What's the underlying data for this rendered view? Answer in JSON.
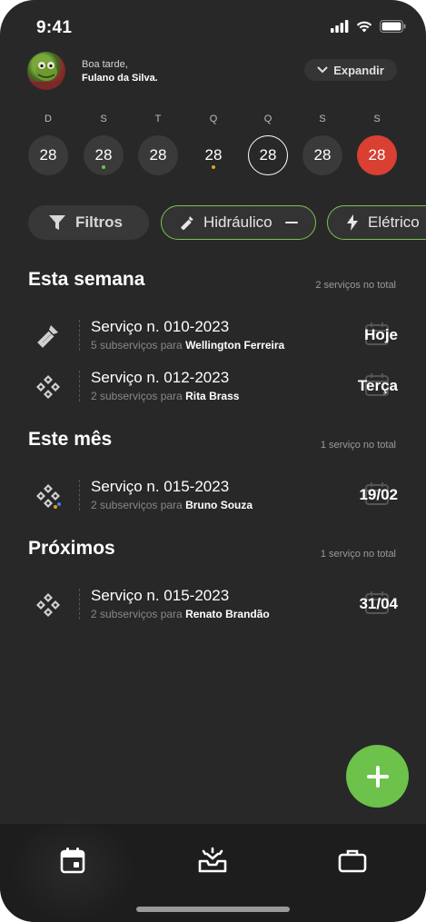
{
  "status": {
    "time": "9:41"
  },
  "header": {
    "greeting": "Boa tarde,",
    "user_name": "Fulano da Silva.",
    "expand_label": "Expandir"
  },
  "week": [
    {
      "letter": "D",
      "day": "28",
      "state": "normal",
      "dot": null
    },
    {
      "letter": "S",
      "day": "28",
      "state": "normal",
      "dot": "#6cc24a"
    },
    {
      "letter": "T",
      "day": "28",
      "state": "normal",
      "dot": null
    },
    {
      "letter": "Q",
      "day": "28",
      "state": "normal",
      "dot": "#e0a020"
    },
    {
      "letter": "Q",
      "day": "28",
      "state": "today",
      "dot": null
    },
    {
      "letter": "S",
      "day": "28",
      "state": "normal",
      "dot": null
    },
    {
      "letter": "S",
      "day": "28",
      "state": "selected",
      "dot": null
    }
  ],
  "filters": {
    "filter_label": "Filtros",
    "chip1_label": "Hidráulico",
    "chip2_label": "Elétrico"
  },
  "sections": [
    {
      "title": "Esta semana",
      "count": "2 serviços no total",
      "items": [
        {
          "icon": "wrench-icon",
          "title": "Serviço n. 010-2023",
          "sub_prefix": "5 subserviços para",
          "person": "Wellington Ferreira",
          "date": "Hoje"
        },
        {
          "icon": "diamond-nodes-icon",
          "title": "Serviço n. 012-2023",
          "sub_prefix": "2 subserviços para",
          "person": "Rita Brass",
          "date": "Terça"
        }
      ]
    },
    {
      "title": "Este mês",
      "count": "1 serviço no total",
      "items": [
        {
          "icon": "diamond-nodes-icon",
          "title": "Serviço n. 015-2023",
          "sub_prefix": "2 subserviços para",
          "person": "Bruno Souza",
          "date": "19/02"
        }
      ]
    },
    {
      "title": "Próximos",
      "count": "1 serviço no total",
      "items": [
        {
          "icon": "diamond-nodes-icon",
          "title": "Serviço n. 015-2023",
          "sub_prefix": "2 subserviços para",
          "person": "Renato Brandão",
          "date": "31/04"
        }
      ]
    }
  ],
  "colors": {
    "accent_green": "#6cc24a",
    "selected_red": "#d94032",
    "background": "#282828"
  },
  "tabbar": {
    "tabs": [
      "calendar-icon",
      "inbox-icon",
      "briefcase-icon"
    ],
    "active": "calendar-icon"
  }
}
